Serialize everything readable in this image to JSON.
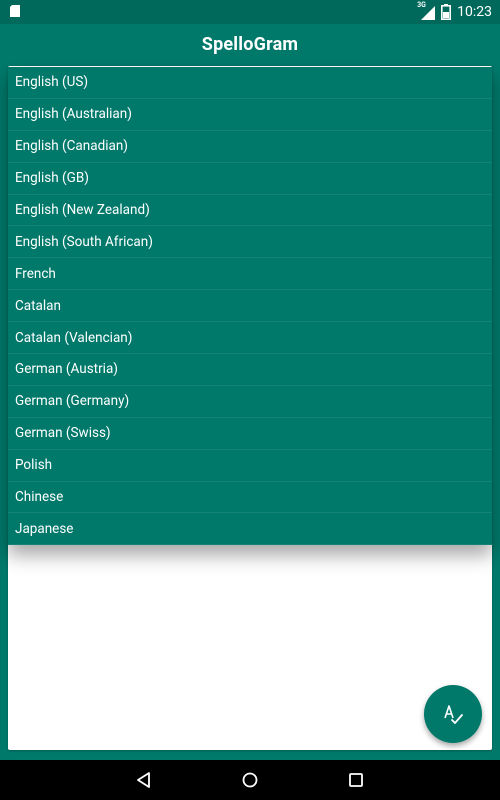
{
  "status_bar": {
    "time": "10:23",
    "network": "3G"
  },
  "app_bar": {
    "title": "SpelloGram"
  },
  "language_dropdown": {
    "items": [
      "English (US)",
      "English (Australian)",
      "English (Canadian)",
      "English (GB)",
      "English (New Zealand)",
      "English (South African)",
      "French",
      "Catalan",
      "Catalan (Valencian)",
      "German (Austria)",
      "German (Germany)",
      "German (Swiss)",
      "Polish",
      "Chinese",
      "Japanese"
    ]
  },
  "fab": {
    "icon": "spellcheck-icon"
  },
  "nav_bar": {
    "back_icon": "back-icon",
    "home_icon": "home-icon",
    "recents_icon": "recents-icon"
  },
  "colors": {
    "primary": "#00796B",
    "primary_dark": "#00695C"
  }
}
